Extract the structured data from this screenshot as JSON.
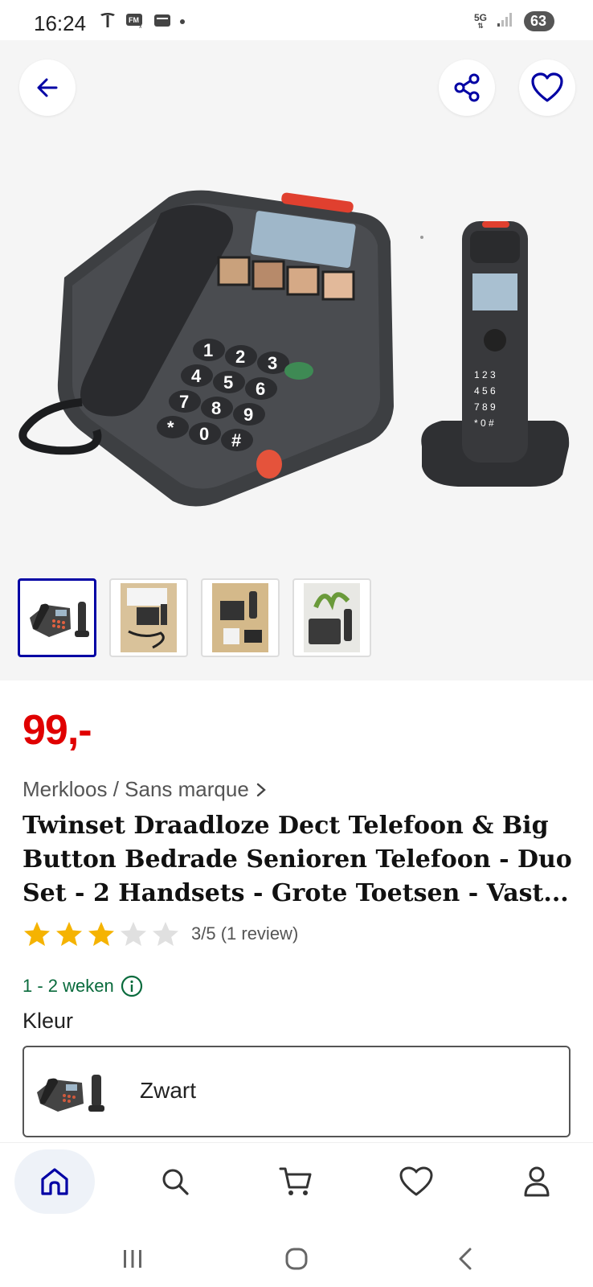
{
  "status_bar": {
    "time": "16:24",
    "network": "5G",
    "battery": "63",
    "icons": [
      "tesla-icon",
      "fm-radio-icon",
      "wallet-icon",
      "notification-dot-icon",
      "signal-icon"
    ]
  },
  "gallery": {
    "back_icon": "arrow-left-icon",
    "share_icon": "share-icon",
    "favorite_icon": "heart-icon",
    "thumbnail_count": 4,
    "selected_thumbnail": 1
  },
  "product": {
    "price": "99,-",
    "brand": "Merkloos / Sans marque",
    "title": "Twinset Draadloze Dect Telefoon & Big Button Bedrade Senioren Telefoon - Duo Set - 2 Handsets - Grote Toetsen - Vast...",
    "rating_value": 3,
    "rating_max": 5,
    "rating_text": "3/5 (1 review)",
    "delivery": "1 - 2 weken",
    "color_label": "Kleur",
    "color_value": "Zwart"
  },
  "colors": {
    "brand_blue": "#0000a4",
    "price_red": "#e00000",
    "delivery_green": "#0a6b3d",
    "star_filled": "#f5b301",
    "star_empty": "#e0e0e0"
  },
  "bottom_nav": [
    {
      "name": "home-icon",
      "active": true
    },
    {
      "name": "search-icon",
      "active": false
    },
    {
      "name": "cart-icon",
      "active": false
    },
    {
      "name": "heart-icon",
      "active": false
    },
    {
      "name": "account-icon",
      "active": false
    }
  ]
}
